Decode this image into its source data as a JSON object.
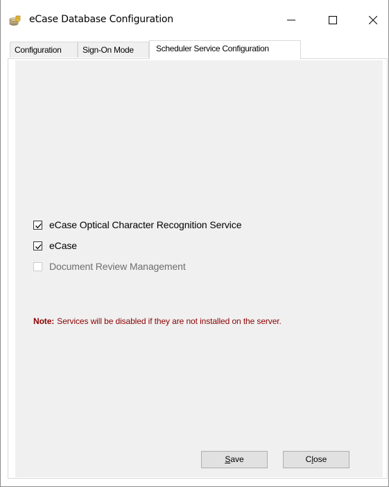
{
  "window": {
    "title": "eCase Database Configuration"
  },
  "icons": {
    "app": "database-config-icon",
    "minimize": "minimize-icon",
    "maximize": "maximize-icon",
    "close": "close-icon",
    "checkmark": "checkmark-icon"
  },
  "tabs": [
    {
      "label": "Configuration",
      "selected": false
    },
    {
      "label": "Sign-On Mode",
      "selected": false
    },
    {
      "label": "Scheduler Service Configuration",
      "selected": true
    }
  ],
  "services": [
    {
      "label": "eCase Optical Character Recognition Service",
      "checked": true,
      "enabled": true
    },
    {
      "label": "eCase",
      "checked": true,
      "enabled": true
    },
    {
      "label": "Document Review Management",
      "checked": false,
      "enabled": false
    }
  ],
  "note": {
    "label": "Note:",
    "text": "Services will be disabled if they are not installed on the server."
  },
  "buttons": {
    "save": {
      "mnemonic": "S",
      "rest": "ave"
    },
    "close": {
      "prefix": "C",
      "mnemonic": "l",
      "rest": "ose"
    }
  },
  "colors": {
    "note_text": "#8b0000",
    "panel_bg": "#f0f0f0",
    "button_bg": "#e1e1e1"
  }
}
